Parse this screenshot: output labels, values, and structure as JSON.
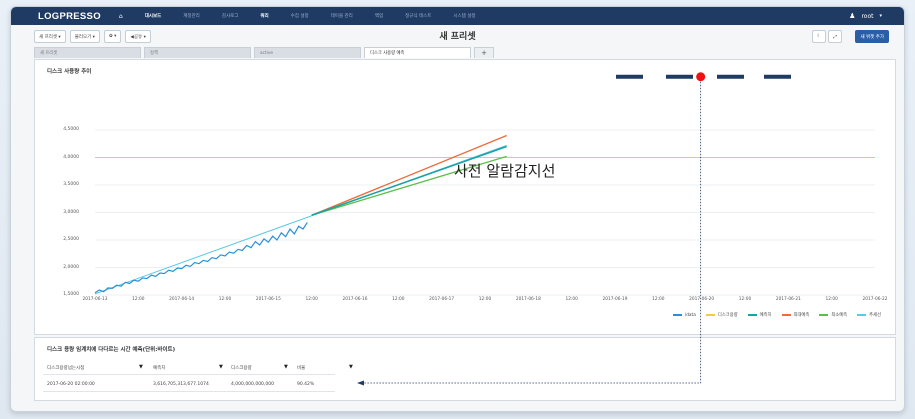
{
  "nav": {
    "logo": "LOGPRESSO",
    "home_icon": "home-icon",
    "items": [
      {
        "label": "대시보드",
        "active": true
      },
      {
        "label": "계정관리",
        "active": false
      },
      {
        "label": "감사로그",
        "active": false
      },
      {
        "label": "쿼리",
        "active": true
      },
      {
        "label": "수집 설정",
        "active": false
      },
      {
        "label": "테이블 관리",
        "active": false
      },
      {
        "label": "백업",
        "active": false
      },
      {
        "label": "정규식 테스트",
        "active": false
      },
      {
        "label": "시스템 설정",
        "active": false
      }
    ],
    "user_icon": "user-icon",
    "user": "root"
  },
  "toolbar": {
    "new_preset": "새 프리셋 ▾",
    "load": "불러오기 ▾",
    "settings": "✿ ▾",
    "share": "◀공유 ▾",
    "preset_title": "새 프리셋",
    "theme_icon": "moon-icon",
    "fullscreen_icon": "expand-icon",
    "add_widget": "새 위젯 추가"
  },
  "tabs": [
    {
      "label": "새 프리셋",
      "active": false
    },
    {
      "label": "정책",
      "active": false
    },
    {
      "label": "active",
      "active": false
    },
    {
      "label": "디스크 사용량 예측",
      "active": true
    }
  ],
  "tab_add": "+",
  "chart_data": {
    "type": "line",
    "title": "디스크 사용량 추이",
    "ylim": [
      1.5,
      4.5
    ],
    "y_ticks": [
      "4,5000",
      "4,0000",
      "3,5000",
      "3,0000",
      "2,5000",
      "2,0000",
      "1,5000"
    ],
    "x_ticks": [
      "2017-06-13",
      "12:00",
      "2017-06-14",
      "12:00",
      "2017-06-15",
      "12:00",
      "2017-06-16",
      "12:00",
      "2017-06-17",
      "12:00",
      "2017-06-18",
      "12:00",
      "2017-06-19",
      "12:00",
      "2017-06-20",
      "12:00",
      "2017-06-21",
      "12:00",
      "2017-06-22"
    ],
    "threshold": 4.0,
    "actual_x": [
      0.0,
      0.1,
      0.2,
      0.3,
      0.4,
      0.5,
      0.6,
      0.7,
      0.8,
      0.9,
      1.0,
      1.1,
      1.2,
      1.3,
      1.4,
      1.5,
      1.6,
      1.7,
      1.8,
      1.9,
      2.0,
      2.1,
      2.2,
      2.3,
      2.4,
      2.5,
      2.6,
      2.7,
      2.8,
      2.9,
      3.0,
      3.1,
      3.2,
      3.3,
      3.4,
      3.5,
      3.6,
      3.7,
      3.8,
      3.9,
      4.0,
      4.1,
      4.2,
      4.3,
      4.4,
      4.5,
      4.6,
      4.7,
      4.8,
      4.9
    ],
    "actual_y": [
      1.54,
      1.59,
      1.56,
      1.63,
      1.62,
      1.68,
      1.66,
      1.73,
      1.71,
      1.77,
      1.75,
      1.81,
      1.8,
      1.86,
      1.84,
      1.9,
      1.89,
      1.95,
      1.93,
      1.99,
      1.98,
      2.04,
      2.02,
      2.09,
      2.07,
      2.13,
      2.11,
      2.18,
      2.16,
      2.23,
      2.21,
      2.28,
      2.26,
      2.33,
      2.31,
      2.4,
      2.36,
      2.47,
      2.41,
      2.52,
      2.46,
      2.57,
      2.5,
      2.63,
      2.56,
      2.7,
      2.61,
      2.75,
      2.7,
      2.82
    ],
    "forecast_x": [
      5.0,
      9.5
    ],
    "forecast_max": [
      2.95,
      4.4
    ],
    "forecast": [
      2.95,
      4.2
    ],
    "forecast_min": [
      2.95,
      4.02
    ],
    "trend_x": [
      0.0,
      9.5
    ],
    "trend": [
      1.52,
      4.22
    ],
    "legend": [
      {
        "name": "/data",
        "color": "#2b8fd6"
      },
      {
        "name": "디스크용량",
        "color": "#f2c94c"
      },
      {
        "name": "예측치",
        "color": "#1aa3a3"
      },
      {
        "name": "최대예측",
        "color": "#ee6b3b"
      },
      {
        "name": "최소예측",
        "color": "#5cbf4a"
      },
      {
        "name": "추세선",
        "color": "#5ac8e6"
      }
    ]
  },
  "annotation": {
    "label": "사전 알람감지선",
    "marker_color": "#ee1111",
    "dash_color": "#1f3a63"
  },
  "table": {
    "title": "디스크 용량 임계치에 다다르는 시간 예측(단위:바이트)",
    "columns": [
      "디스크용량넘는시점",
      "예측치",
      "디스크용량",
      "비율"
    ],
    "row": [
      "2017-06-20 02:00:00",
      "3,616,705,313,677.1074",
      "4,000,000,000,000",
      "90.42%"
    ],
    "filter_icon": "filter-icon"
  }
}
